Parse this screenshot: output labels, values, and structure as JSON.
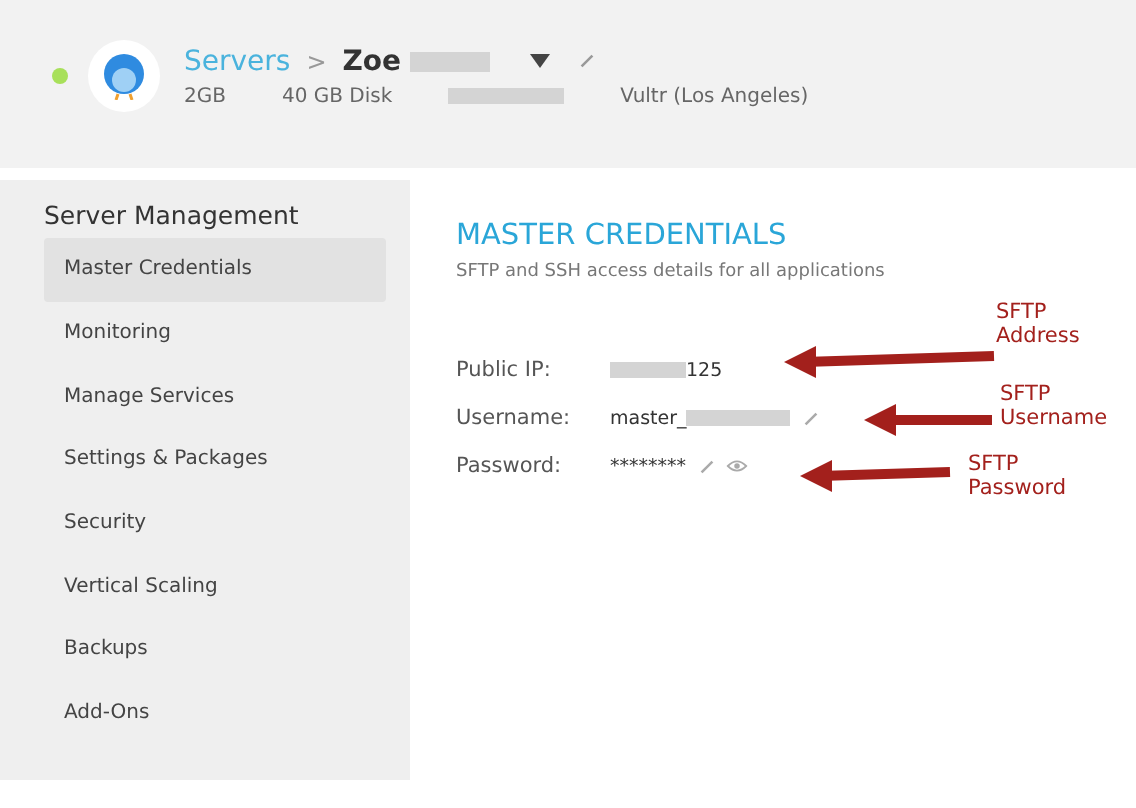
{
  "header": {
    "status": {
      "online": true
    },
    "breadcrumb": {
      "parent": "Servers",
      "separator": ">",
      "current": "Zoe"
    },
    "specs": [
      "2GB",
      "40 GB Disk",
      "Vultr (Los Angeles)"
    ]
  },
  "sidebar": {
    "title": "Server Management",
    "items": [
      {
        "label": "Master Credentials",
        "selected": true
      },
      {
        "label": "Monitoring",
        "selected": false
      },
      {
        "label": "Manage Services",
        "selected": false
      },
      {
        "label": "Settings & Packages",
        "selected": false
      },
      {
        "label": "Security",
        "selected": false
      },
      {
        "label": "Vertical Scaling",
        "selected": false
      },
      {
        "label": "Backups",
        "selected": false
      },
      {
        "label": "Add-Ons",
        "selected": false
      }
    ]
  },
  "content": {
    "title": "MASTER CREDENTIALS",
    "subtitle": "SFTP and SSH access details for all applications",
    "fields": [
      {
        "label": "Public IP:",
        "value": "125",
        "masked_before": true,
        "masked_after": false,
        "editable": false,
        "revealable": false
      },
      {
        "label": "Username:",
        "value": "master_",
        "masked_before": false,
        "masked_after": true,
        "editable": true,
        "revealable": false
      },
      {
        "label": "Password:",
        "value": "********",
        "masked_before": false,
        "masked_after": false,
        "editable": true,
        "revealable": true
      }
    ]
  },
  "annotations": [
    {
      "lines": [
        "SFTP",
        "Address"
      ]
    },
    {
      "lines": [
        "SFTP",
        "Username"
      ]
    },
    {
      "lines": [
        "SFTP",
        "Password"
      ]
    }
  ]
}
